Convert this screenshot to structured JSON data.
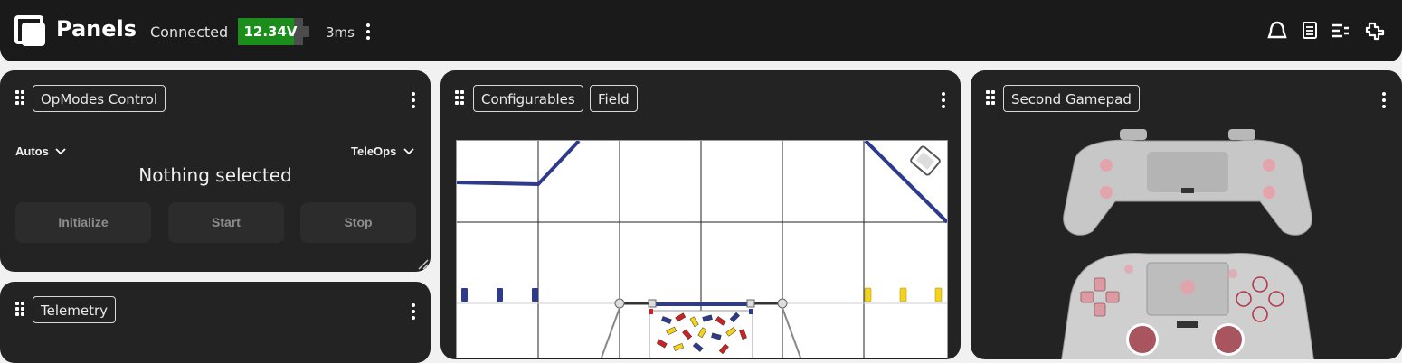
{
  "app": {
    "title": "Panels",
    "status": "Connected",
    "battery_voltage": "12.34V",
    "battery_level": 0.86,
    "latency": "3ms"
  },
  "toolbar_icons": [
    "bell-icon",
    "document-icon",
    "list-icon",
    "plugin-icon"
  ],
  "colors": {
    "battery_green": "#1b8d1b",
    "panel_bg": "#232323",
    "topbar_bg": "#1a1a1a"
  },
  "opmodes_panel": {
    "tab": "OpModes Control",
    "autos_label": "Autos",
    "teleops_label": "TeleOps",
    "selection": "Nothing selected",
    "buttons": {
      "initialize": "Initialize",
      "start": "Start",
      "stop": "Stop"
    }
  },
  "telemetry_panel": {
    "tab": "Telemetry"
  },
  "center_panel": {
    "tabs": [
      "Configurables",
      "Field"
    ]
  },
  "gamepad_panel": {
    "tab": "Second Gamepad"
  }
}
